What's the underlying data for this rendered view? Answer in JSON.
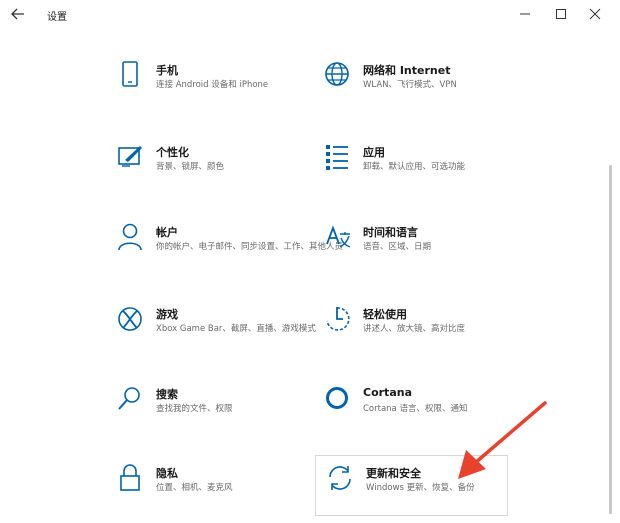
{
  "window": {
    "title": "设置"
  },
  "items": [
    {
      "title": "手机",
      "desc": "连接 Android 设备和 iPhone",
      "icon": "phone-icon"
    },
    {
      "title": "网络和 Internet",
      "desc": "WLAN、飞行模式、VPN",
      "icon": "globe-icon"
    },
    {
      "title": "个性化",
      "desc": "背景、锁屏、颜色",
      "icon": "personalization-icon"
    },
    {
      "title": "应用",
      "desc": "卸载、默认应用、可选功能",
      "icon": "apps-list-icon"
    },
    {
      "title": "帐户",
      "desc": "你的帐户、电子邮件、同步设置、工作、其他人员",
      "icon": "person-icon"
    },
    {
      "title": "时间和语言",
      "desc": "语音、区域、日期",
      "icon": "time-language-icon"
    },
    {
      "title": "游戏",
      "desc": "Xbox Game Bar、截屏、直播、游戏模式",
      "icon": "xbox-icon"
    },
    {
      "title": "轻松使用",
      "desc": "讲述人、放大镜、高对比度",
      "icon": "ease-of-access-icon"
    },
    {
      "title": "搜索",
      "desc": "查找我的文件、权限",
      "icon": "search-icon"
    },
    {
      "title": "Cortana",
      "desc": "Cortana 语言、权限、通知",
      "icon": "cortana-icon"
    },
    {
      "title": "隐私",
      "desc": "位置、相机、麦克风",
      "icon": "lock-icon"
    },
    {
      "title": "更新和安全",
      "desc": "Windows 更新、恢复、备份",
      "icon": "update-sync-icon"
    }
  ],
  "colors": {
    "accent": "#0063b1",
    "arrow": "#e8412c"
  }
}
